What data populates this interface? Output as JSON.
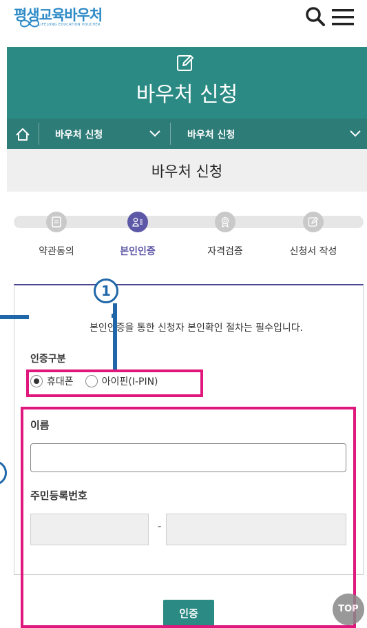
{
  "header": {
    "logo_text": "평생교육바우처",
    "logo_sub": "LIFELONG EDUCATION VOUCHER",
    "search_icon": "search-icon",
    "menu_icon": "hamburger-menu-icon"
  },
  "banner": {
    "icon": "edit-icon",
    "title": "바우처 신청"
  },
  "breadcrumb": {
    "home_icon": "home-icon",
    "level1": "바우처 신청",
    "level2": "바우처 신청"
  },
  "page_title": "바우처 신청",
  "steps": [
    {
      "label": "약관동의",
      "icon": "document-icon",
      "active": false
    },
    {
      "label": "본인인증",
      "icon": "user-list-icon",
      "active": true
    },
    {
      "label": "자격검증",
      "icon": "badge-icon",
      "active": false
    },
    {
      "label": "신청서 작성",
      "icon": "edit-icon",
      "active": false
    }
  ],
  "form": {
    "notice": "본인인증을 통한 신청자 본인확인 절차는 필수입니다.",
    "auth_type_label": "인증구분",
    "auth_options": [
      {
        "label": "휴대폰",
        "selected": true
      },
      {
        "label": "아이핀(I-PIN)",
        "selected": false
      }
    ],
    "name_label": "이름",
    "name_value": "",
    "rrn_label": "주민등록번호",
    "rrn_separator": "-",
    "submit_label": "인증"
  },
  "annotations": {
    "marker_1": "1",
    "highlight_color": "#e0177c",
    "marker_color": "#1f67a8"
  },
  "top_button": "TOP",
  "colors": {
    "teal": "#2b8a83",
    "purple": "#5c57a6"
  }
}
